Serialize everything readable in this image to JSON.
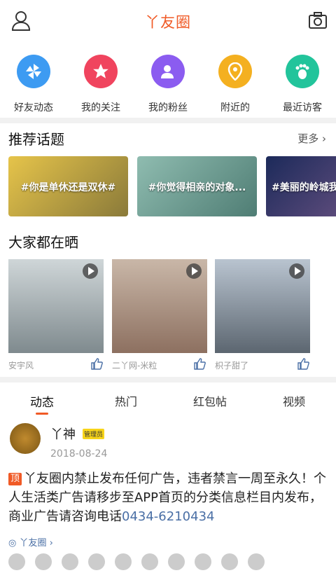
{
  "header": {
    "title": "丫友圈",
    "user_icon": "user-icon",
    "camera_icon": "camera-icon"
  },
  "quick": [
    {
      "label": "好友动态",
      "icon": "pinwheel-icon",
      "color": "#3d9bf2"
    },
    {
      "label": "我的关注",
      "icon": "star-icon",
      "color": "#f0445e"
    },
    {
      "label": "我的粉丝",
      "icon": "person-heart-icon",
      "color": "#8b5cf0"
    },
    {
      "label": "附近的",
      "icon": "location-pin-icon",
      "color": "#f4b020"
    },
    {
      "label": "最近访客",
      "icon": "footprint-icon",
      "color": "#22c49b"
    }
  ],
  "topics": {
    "title": "推荐话题",
    "more": "更多",
    "items": [
      {
        "label": "#你是单休还是双休#",
        "color": "#d9b23a"
      },
      {
        "label": "#你觉得相亲的对象...",
        "color": "#6fa49a"
      },
      {
        "label": "#美丽的岭城我",
        "color": "#2b3a6e"
      }
    ]
  },
  "shows": {
    "title": "大家都在晒",
    "items": [
      {
        "author": "安宇风",
        "color": "#9aa4a8"
      },
      {
        "author": "二丫网-米粒",
        "color": "#b89a8a"
      },
      {
        "author": "枳子甜了",
        "color": "#8a96a4"
      }
    ]
  },
  "tabs": [
    "动态",
    "热门",
    "红包帖",
    "视频"
  ],
  "post": {
    "name": "丫神",
    "badge": "管理员",
    "date": "2018-08-24",
    "pin": "顶",
    "body": "丫友圈内禁止发布任何广告，违者禁言一周至永久！个人生活类广告请移步至APP首页的分类信息栏目内发布，商业广告请咨询电话",
    "phone": "0434-6210434",
    "source": "丫友圈"
  }
}
